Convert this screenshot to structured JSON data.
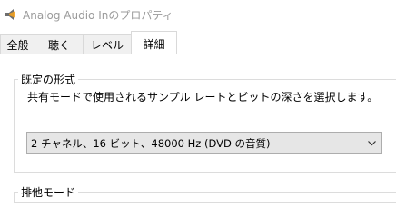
{
  "window": {
    "title": "Analog Audio Inのプロパティ"
  },
  "tabs": [
    {
      "label": "全般"
    },
    {
      "label": "聴く"
    },
    {
      "label": "レベル"
    },
    {
      "label": "詳細"
    }
  ],
  "active_tab": "詳細",
  "default_format": {
    "group_label": "既定の形式",
    "description": "共有モードで使用されるサンプル レートとビットの深さを選択します。",
    "selected": "2 チャネル、16 ビット、48000 Hz (DVD の音質)"
  },
  "exclusive_mode": {
    "group_label": "排他モード"
  },
  "icons": {
    "app": "speaker-icon",
    "dropdown": "chevron-down-icon"
  }
}
